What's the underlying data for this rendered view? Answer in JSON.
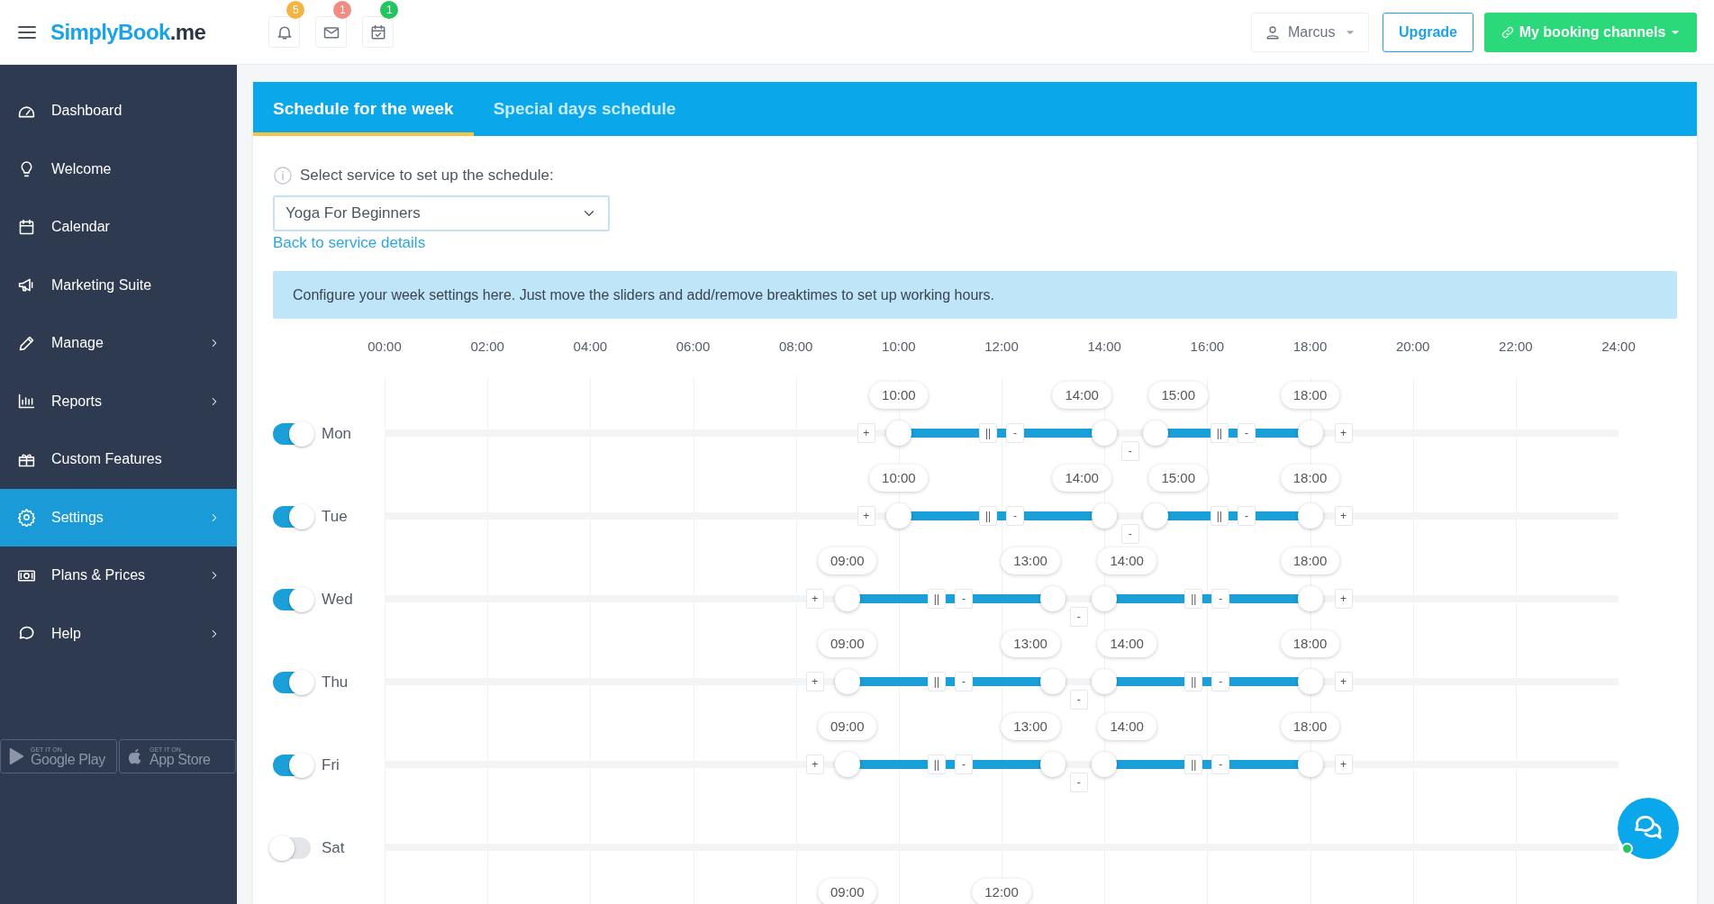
{
  "header": {
    "logo": {
      "name": "SimplyBook",
      "suffix": ".me"
    },
    "notifications": [
      {
        "kind": "bell",
        "count": "5",
        "color": "#f5b342"
      },
      {
        "kind": "mail",
        "count": "1",
        "color": "#f28b82"
      },
      {
        "kind": "calendar",
        "count": "1",
        "color": "#22c55e"
      }
    ],
    "user": "Marcus",
    "upgrade": "Upgrade",
    "channels": "My booking channels"
  },
  "sidebar": {
    "items": [
      {
        "label": "Dashboard",
        "submenu": false,
        "selected": false
      },
      {
        "label": "Welcome",
        "submenu": false,
        "selected": false
      },
      {
        "label": "Calendar",
        "submenu": false,
        "selected": false
      },
      {
        "label": "Marketing Suite",
        "submenu": false,
        "selected": false
      },
      {
        "label": "Manage",
        "submenu": true,
        "selected": false
      },
      {
        "label": "Reports",
        "submenu": true,
        "selected": false
      },
      {
        "label": "Custom Features",
        "submenu": false,
        "selected": false
      },
      {
        "label": "Settings",
        "submenu": true,
        "selected": true
      },
      {
        "label": "Plans & Prices",
        "submenu": true,
        "selected": false
      },
      {
        "label": "Help",
        "submenu": true,
        "selected": false
      }
    ],
    "stores": [
      {
        "kind": "google",
        "small": "GET IT ON",
        "label": "Google Play"
      },
      {
        "kind": "apple",
        "small": "GET IT ON",
        "label": "App Store"
      }
    ]
  },
  "tabs": [
    {
      "label": "Schedule for the week",
      "selected": true
    },
    {
      "label": "Special days schedule",
      "selected": false
    }
  ],
  "service": {
    "label": "Select service to set up the schedule:",
    "value": "Yoga For Beginners",
    "link": "Back to service details"
  },
  "info": "Configure your week settings here. Just move the sliders and add/remove breaktimes to set up working hours.",
  "hours": [
    "00:00",
    "02:00",
    "04:00",
    "06:00",
    "08:00",
    "10:00",
    "12:00",
    "14:00",
    "16:00",
    "18:00",
    "20:00",
    "22:00",
    "24:00"
  ],
  "slider_buttons": {
    "add": "+",
    "remove": "-",
    "pause": "||"
  },
  "days": [
    {
      "kind": "day",
      "label": "Mon",
      "on": true,
      "ranges": [
        {
          "start": "10:00",
          "end": "14:00"
        },
        {
          "start": "15:00",
          "end": "18:00"
        }
      ]
    },
    {
      "kind": "day",
      "label": "Tue",
      "on": true,
      "ranges": [
        {
          "start": "10:00",
          "end": "14:00"
        },
        {
          "start": "15:00",
          "end": "18:00"
        }
      ]
    },
    {
      "kind": "day",
      "label": "Wed",
      "on": true,
      "ranges": [
        {
          "start": "09:00",
          "end": "13:00"
        },
        {
          "start": "14:00",
          "end": "18:00"
        }
      ]
    },
    {
      "kind": "day",
      "label": "Thu",
      "on": true,
      "ranges": [
        {
          "start": "09:00",
          "end": "13:00"
        },
        {
          "start": "14:00",
          "end": "18:00"
        }
      ]
    },
    {
      "kind": "day",
      "label": "Fri",
      "on": true,
      "ranges": [
        {
          "start": "09:00",
          "end": "13:00"
        },
        {
          "start": "14:00",
          "end": "18:00"
        }
      ]
    },
    {
      "kind": "day",
      "label": "Sat",
      "on": false
    },
    {
      "kind": "partial",
      "ranges": [
        {
          "start": "09:00",
          "end": "12:00"
        }
      ]
    }
  ]
}
